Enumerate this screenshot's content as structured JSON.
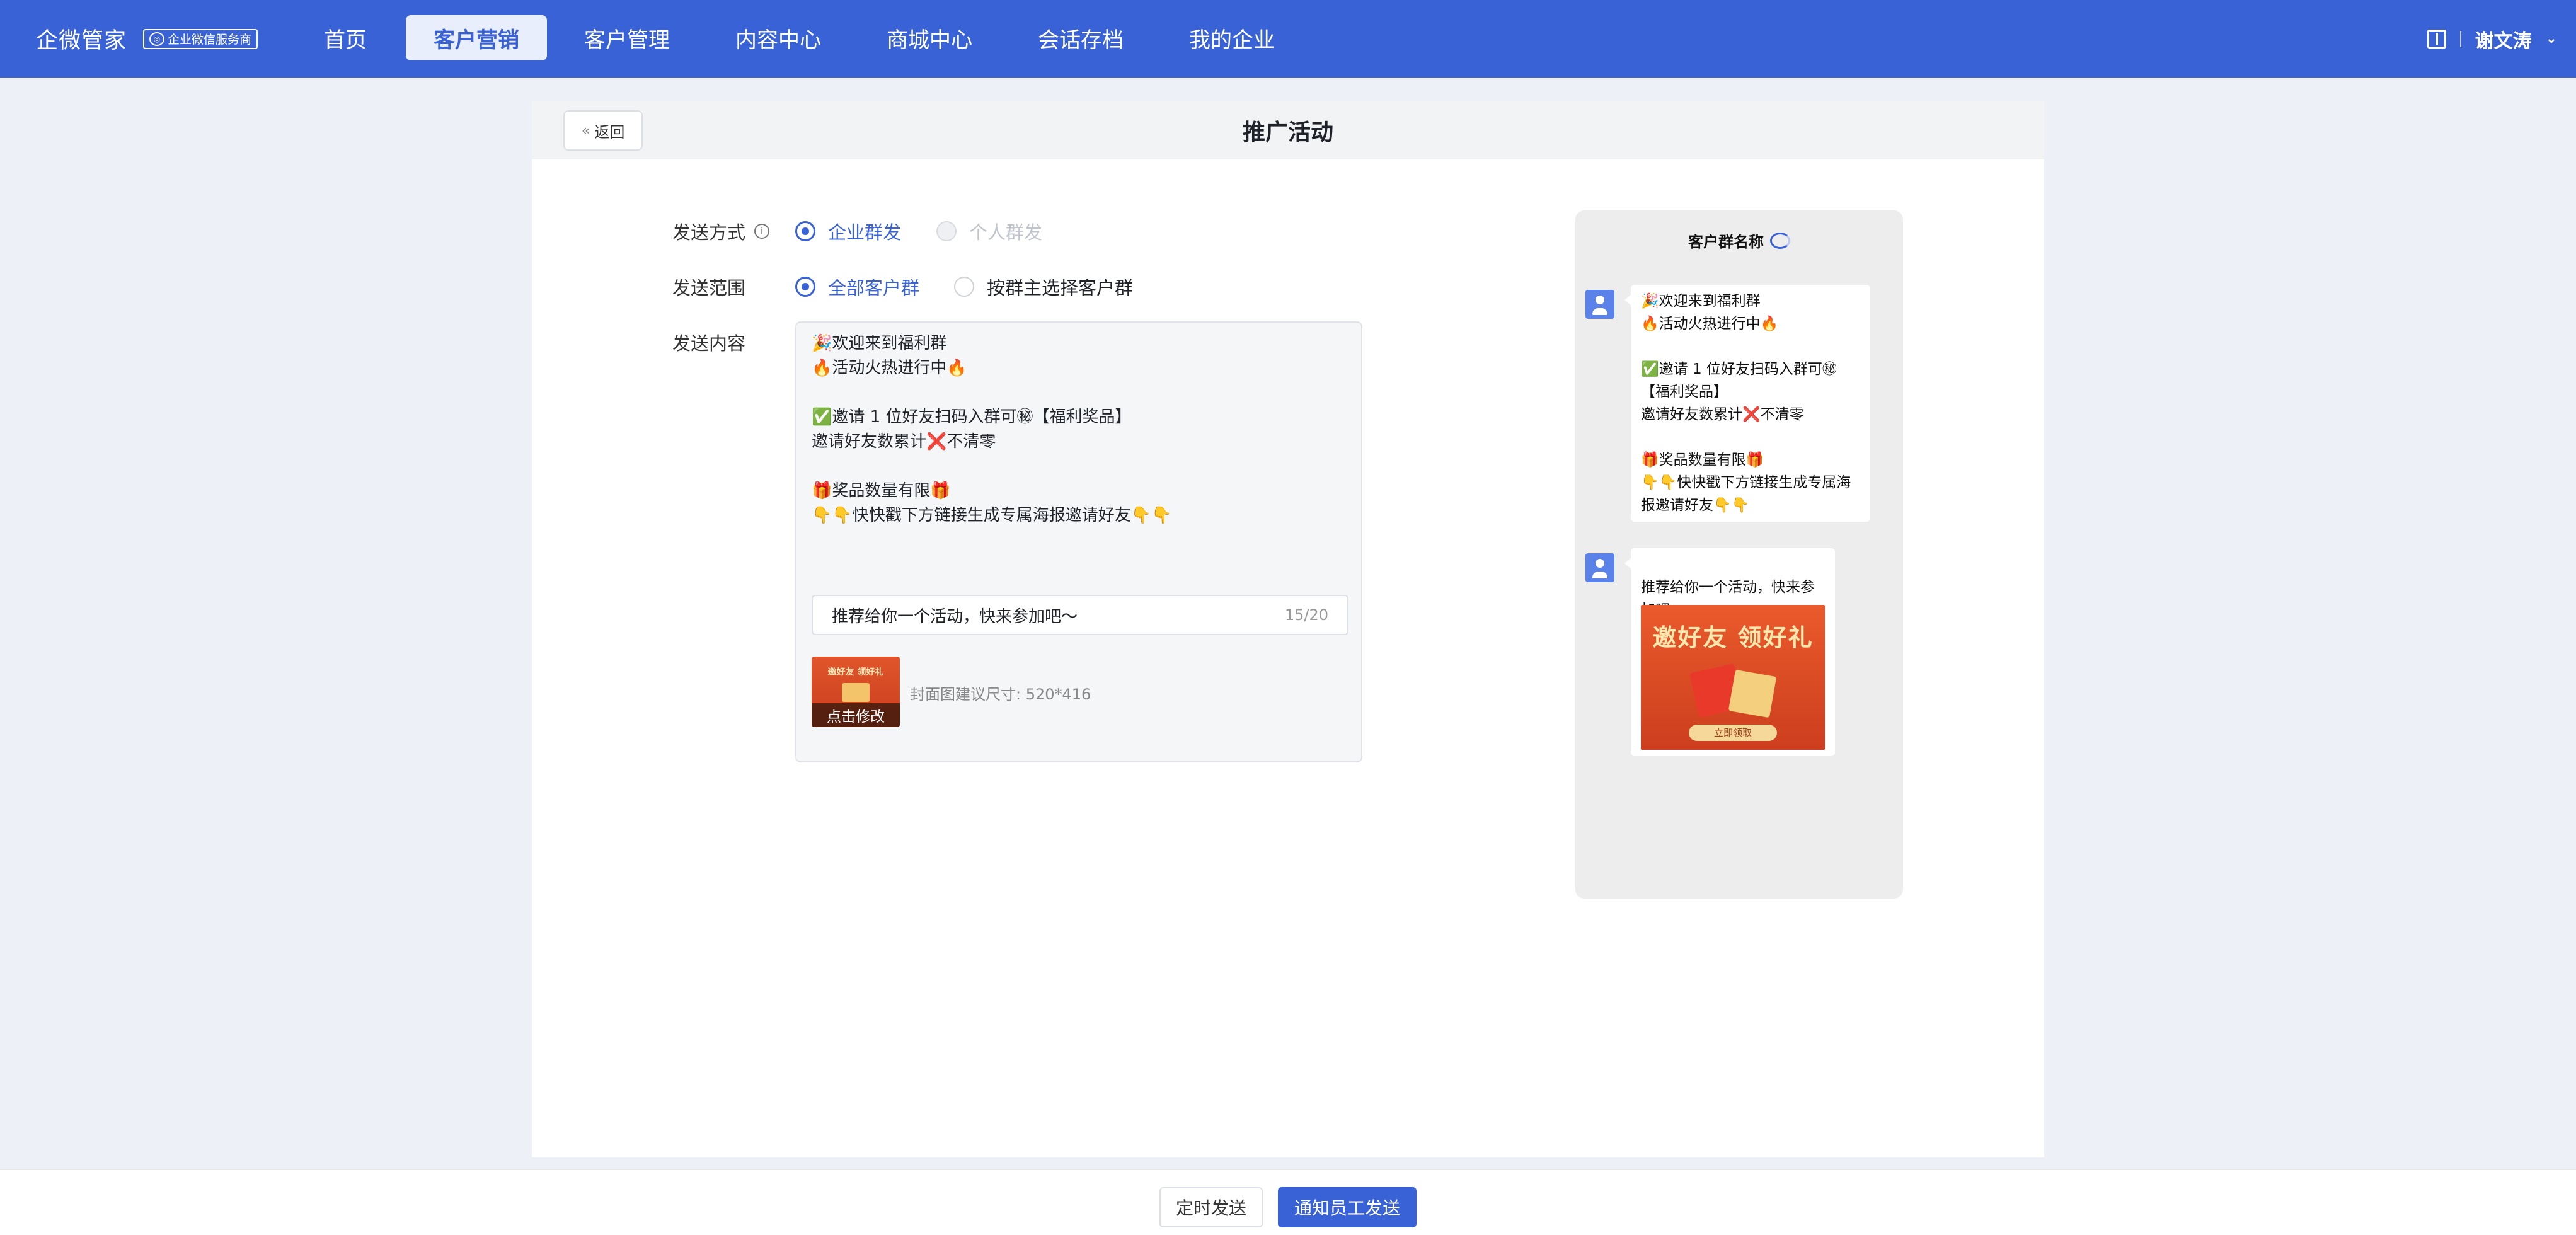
{
  "brand": {
    "name": "企微管家",
    "badge": "企业微信服务商"
  },
  "nav": {
    "items": [
      {
        "label": "首页"
      },
      {
        "label": "客户营销",
        "active": true
      },
      {
        "label": "客户管理"
      },
      {
        "label": "内容中心"
      },
      {
        "label": "商城中心"
      },
      {
        "label": "会话存档"
      },
      {
        "label": "我的企业"
      }
    ],
    "user_name": "谢文涛"
  },
  "page": {
    "back_label": "返回",
    "title": "推广活动"
  },
  "form": {
    "send_mode": {
      "label": "发送方式",
      "options": [
        {
          "label": "企业群发",
          "checked": true
        },
        {
          "label": "个人群发",
          "disabled": true
        }
      ]
    },
    "send_scope": {
      "label": "发送范围",
      "options": [
        {
          "label": "全部客户群",
          "checked": true
        },
        {
          "label": "按群主选择客户群"
        }
      ]
    },
    "content": {
      "label": "发送内容",
      "text": "🎉欢迎来到福利群\n🔥活动火热进行中🔥\n\n✅邀请 1 位好友扫码入群可㊙【福利奖品】\n邀请好友数累计❌不清零\n\n🎁奖品数量有限🎁\n👇👇快快戳下方链接生成专属海报邀请好友👇👇",
      "link_title": "推荐给你一个活动，快来参加吧～",
      "link_count": "15/20",
      "cover_title": "邀好友 领好礼",
      "cover_edit": "点击修改",
      "cover_hint": "封面图建议尺寸: 520*416"
    }
  },
  "preview": {
    "group_name": "客户群名称",
    "message_text": "🎉欢迎来到福利群\n🔥活动火热进行中🔥\n\n✅邀请 1 位好友扫码入群可㊙\n【福利奖品】\n邀请好友数累计❌不清零\n\n🎁奖品数量有限🎁\n👇👇快快戳下方链接生成专属海\n报邀请好友👇👇",
    "link_text": "推荐给你一个活动，快来参\n加吧～",
    "card_title": "邀好友 领好礼",
    "card_button": "立即领取"
  },
  "footer": {
    "schedule_label": "定时发送",
    "notify_label": "通知员工发送"
  },
  "colors": {
    "primary": "#3a62d7",
    "nav_bg": "#3a62d7",
    "page_bg": "#eef0f7"
  }
}
